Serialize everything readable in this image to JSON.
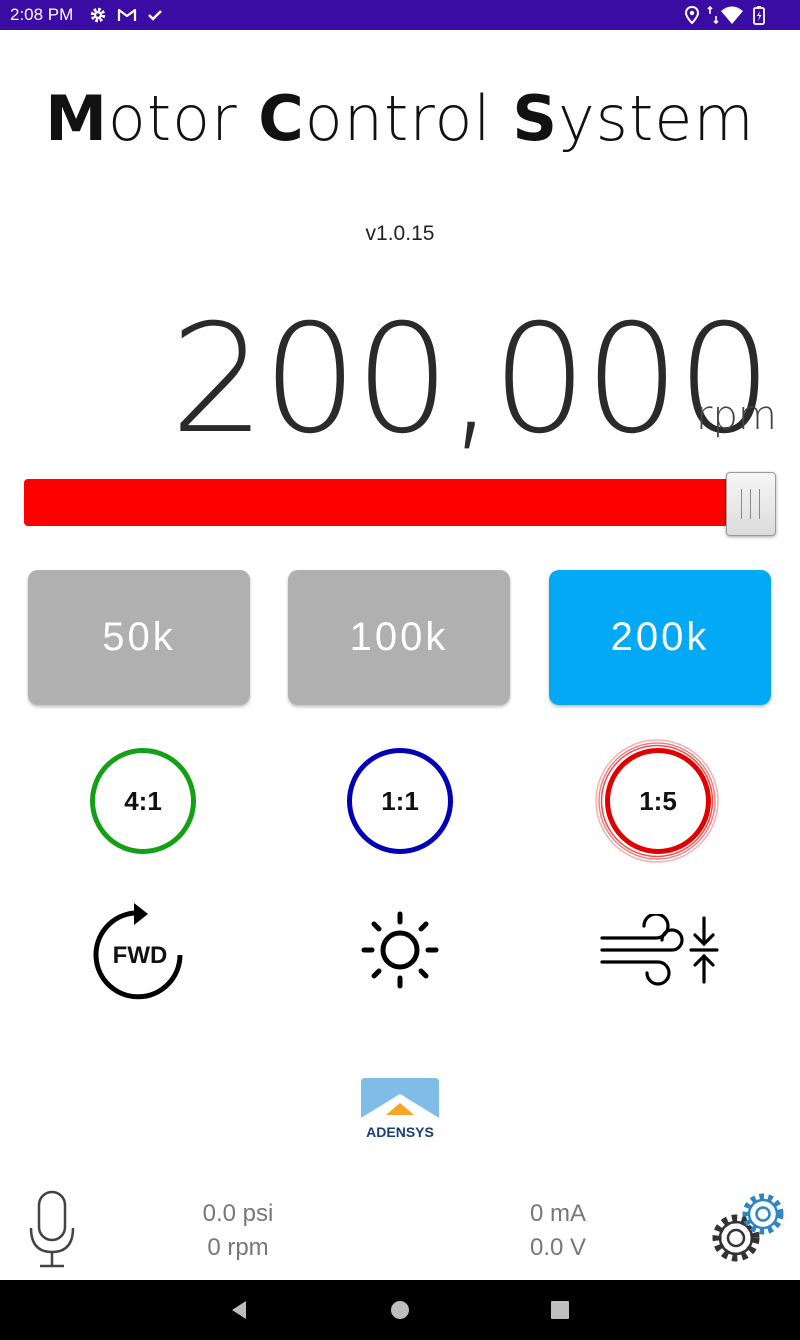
{
  "status_bar": {
    "time": "2:08 PM",
    "left_icons": [
      "gear-icon",
      "gmail-icon",
      "check-icon"
    ],
    "right_icons": [
      "location-icon",
      "data-arrows-icon",
      "wifi-icon",
      "battery-charging-icon"
    ],
    "background": "#3a0ca3"
  },
  "header": {
    "title_parts": [
      {
        "strong": "M",
        "rest": "otor "
      },
      {
        "strong": "C",
        "rest": "ontrol "
      },
      {
        "strong": "S",
        "rest": "ystem"
      }
    ],
    "version": "v1.0.15"
  },
  "speed": {
    "value": "200,000",
    "unit": "rpm",
    "slider_fraction": 1.0,
    "fill_color": "#ff0000"
  },
  "presets": [
    {
      "label": "50k",
      "selected": false
    },
    {
      "label": "100k",
      "selected": false
    },
    {
      "label": "200k",
      "selected": true
    }
  ],
  "preset_colors": {
    "selected": "#03a9f4",
    "unselected": "#b0b0b0"
  },
  "ratios": [
    {
      "label": "4:1",
      "color": "#14a014",
      "active": false
    },
    {
      "label": "1:1",
      "color": "#0000b4",
      "active": false
    },
    {
      "label": "1:5",
      "color": "#e00000",
      "active": true
    }
  ],
  "controls": {
    "direction_label": "FWD",
    "direction_icon": "rotate-clockwise-icon",
    "light_icon": "sun-icon",
    "air_icon": "wind-compress-icon"
  },
  "logo": {
    "text": "ADENSYS"
  },
  "readings": {
    "pressure": "0.0 psi",
    "rpm": "0 rpm",
    "current": "0 mA",
    "voltage": "0.0 V"
  },
  "bottom_icons": {
    "mic": "microphone-icon",
    "settings": "settings-gears-icon"
  },
  "nav": {
    "back": "back-icon",
    "home": "home-icon",
    "recents": "recents-icon"
  }
}
